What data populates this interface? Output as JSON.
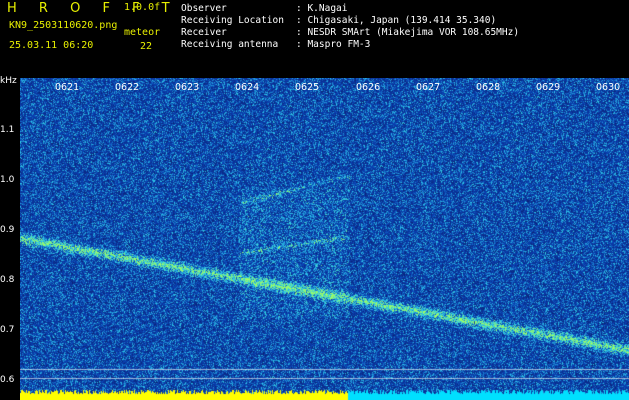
{
  "header": {
    "title": "H R O F F T",
    "version": "1.0.0f",
    "filename": "KN9_2503110620.png",
    "timestamp": "25.03.11 06:20",
    "meteor_label": "meteor",
    "meteor_count": "22"
  },
  "info": [
    {
      "label": "Observer",
      "value": ": K.Nagai"
    },
    {
      "label": "Receiving Location",
      "value": ": Chigasaki, Japan (139.414 35.340)"
    },
    {
      "label": "Receiver",
      "value": ": NESDR SMArt (Miakejima VOR 108.65MHz)"
    },
    {
      "label": "Receiving antenna",
      "value": ": Maspro FM-3"
    }
  ],
  "axis": {
    "y_unit": "kHz",
    "y_ticks": [
      "1.1",
      "1.0",
      "0.9",
      "0.8",
      "0.7",
      "0.6"
    ],
    "x_ticks": [
      "0621",
      "0622",
      "0623",
      "0624",
      "0625",
      "0626",
      "0627",
      "0628",
      "0629",
      "0630"
    ]
  },
  "colors": {
    "header_text": "#e8f000",
    "background_noise": "#0a2a8a",
    "signal": "#00e060",
    "bottom_bar_yellow": "#ffff00",
    "bottom_bar_cyan": "#00e0ff"
  }
}
